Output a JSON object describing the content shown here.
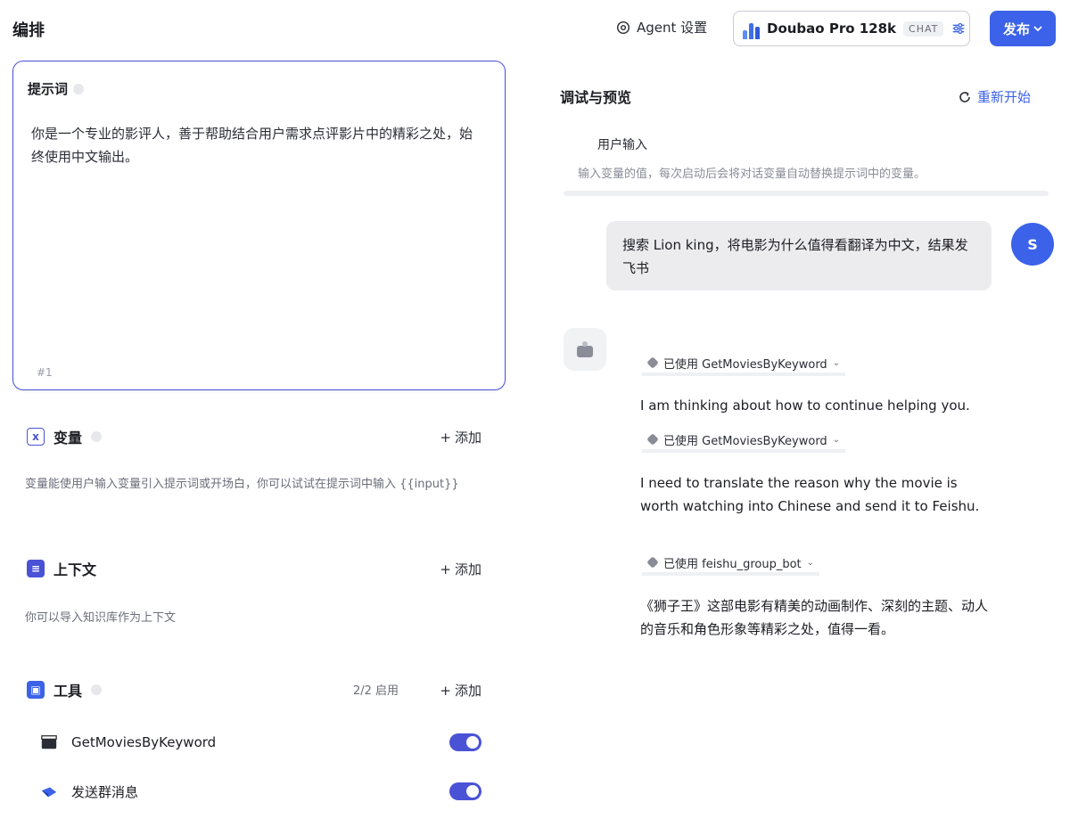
{
  "header": {
    "title": "编排",
    "agent_settings_label": "Agent 设置",
    "model": {
      "name": "Doubao Pro 128k",
      "chip": "CHAT"
    },
    "publish_label": "发布"
  },
  "prompt": {
    "title": "提示词",
    "text": "你是一个专业的影评人，善于帮助结合用户需求点评影片中的精彩之处，始终使用中文输出。",
    "count": "#1"
  },
  "variables": {
    "title": "变量",
    "add_label": "添加",
    "description": "变量能使用户输入变量引入提示词或开场白，你可以试试在提示词中输入 {{input}}"
  },
  "context": {
    "title": "上下文",
    "add_label": "添加",
    "description": "你可以导入知识库作为上下文"
  },
  "tools": {
    "title": "工具",
    "enabled_count": "2/2 启用",
    "add_label": "添加",
    "items": [
      {
        "label": "GetMoviesByKeyword",
        "enabled": true
      },
      {
        "label": "发送群消息",
        "enabled": true
      }
    ]
  },
  "debug": {
    "title": "调试与预览",
    "restart_label": "重新开始",
    "user_input_label": "用户输入",
    "user_input_hint": "输入变量的值，每次启动后会将对话变量自动替换提示词中的变量。"
  },
  "chat": {
    "user_avatar": "S",
    "user_message": "搜索 Lion king，将电影为什么值得看翻译为中文，结果发飞书",
    "bot": [
      {
        "kind": "tool",
        "label": "已使用 GetMoviesByKeyword"
      },
      {
        "kind": "text",
        "text": "I am thinking about how to continue helping you."
      },
      {
        "kind": "tool",
        "label": "已使用 GetMoviesByKeyword"
      },
      {
        "kind": "text",
        "text": "I need to translate the reason why the movie is worth watching into Chinese and send it to Feishu."
      },
      {
        "kind": "tool",
        "label": "已使用 feishu_group_bot"
      },
      {
        "kind": "text",
        "text": "《狮子王》这部电影有精美的动画制作、深刻的主题、动人的音乐和角色形象等精彩之处，值得一看。"
      }
    ]
  },
  "colors": {
    "accent": "#3b62e8",
    "purple": "#4a52d6"
  }
}
